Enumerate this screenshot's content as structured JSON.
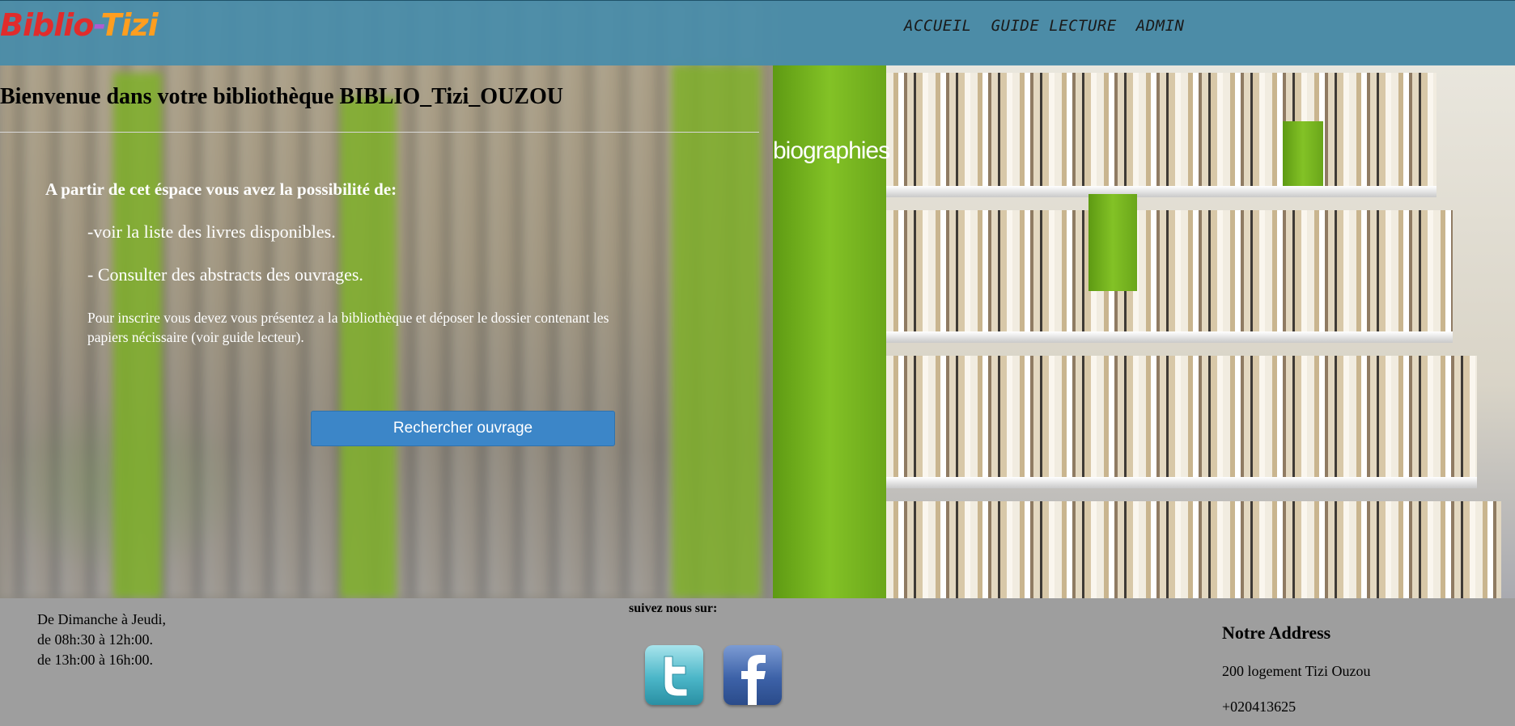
{
  "header": {
    "logo_part1": "Biblio",
    "logo_part2": "-",
    "logo_part3": "Tizi",
    "nav": [
      "ACCUEIL",
      "GUIDE LECTURE",
      "ADMIN"
    ]
  },
  "hero": {
    "shelf_label": "biographies"
  },
  "main": {
    "title": "Bienvenue dans votre bibliothèque BIBLIO_Tizi_OUZOU",
    "intro": "A partir de cet éspace vous avez la possibilité de:",
    "bullets": [
      "-voir la liste des livres disponibles.",
      "- Consulter des abstracts des ouvrages."
    ],
    "note": "Pour inscrire vous devez vous présentez a la bibliothèque et déposer le dossier contenant les papiers nécissaire (voir guide lecteur).",
    "search_button": "Rechercher ouvrage"
  },
  "footer": {
    "hours": [
      "De Dimanche à Jeudi,",
      "de 08h:30 à 12h:00.",
      "de 13h:00 à 16h:00."
    ],
    "follow_label": "suivez nous sur:",
    "social": [
      {
        "name": "twitter",
        "icon": "twitter-icon"
      },
      {
        "name": "facebook",
        "icon": "facebook-icon"
      }
    ],
    "address_title": "Notre Address",
    "address_line": "200 logement Tizi Ouzou",
    "phone": "+020413625"
  },
  "colors": {
    "header_bg": "#468caa",
    "accent_green": "#7fb02a",
    "button_blue": "#3c86c8",
    "footer_bg": "#9e9e9e",
    "logo_red": "#e02c2c",
    "logo_orange": "#ff9e1f"
  }
}
